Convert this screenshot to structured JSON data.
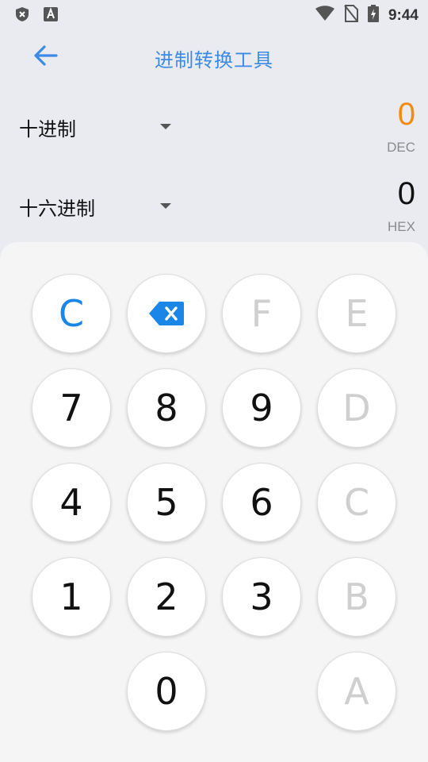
{
  "status_bar": {
    "time": "9:44",
    "icons_left": [
      "shield-x-icon",
      "font-a-icon"
    ],
    "icons_right": [
      "wifi-icon",
      "no-sim-icon",
      "battery-charging-icon"
    ]
  },
  "app_bar": {
    "title": "进制转换工具",
    "back_icon": "arrow-left-icon"
  },
  "from": {
    "base": "十进制",
    "value": "0",
    "unit": "DEC",
    "value_color": "#f28c0f"
  },
  "to": {
    "base": "十六进制",
    "value": "0",
    "unit": "HEX",
    "value_color": "#111111"
  },
  "keypad": {
    "clear": "C",
    "backspace_icon": "backspace-icon",
    "keys": {
      "f": "F",
      "e": "E",
      "d": "D",
      "c": "C",
      "b": "B",
      "a": "A",
      "n7": "7",
      "n8": "8",
      "n9": "9",
      "n4": "4",
      "n5": "5",
      "n6": "6",
      "n1": "1",
      "n2": "2",
      "n3": "3",
      "n0": "0"
    },
    "colors": {
      "accent": "#1a86e8",
      "disabled": "#cfcfcf",
      "digit": "#111111"
    }
  }
}
